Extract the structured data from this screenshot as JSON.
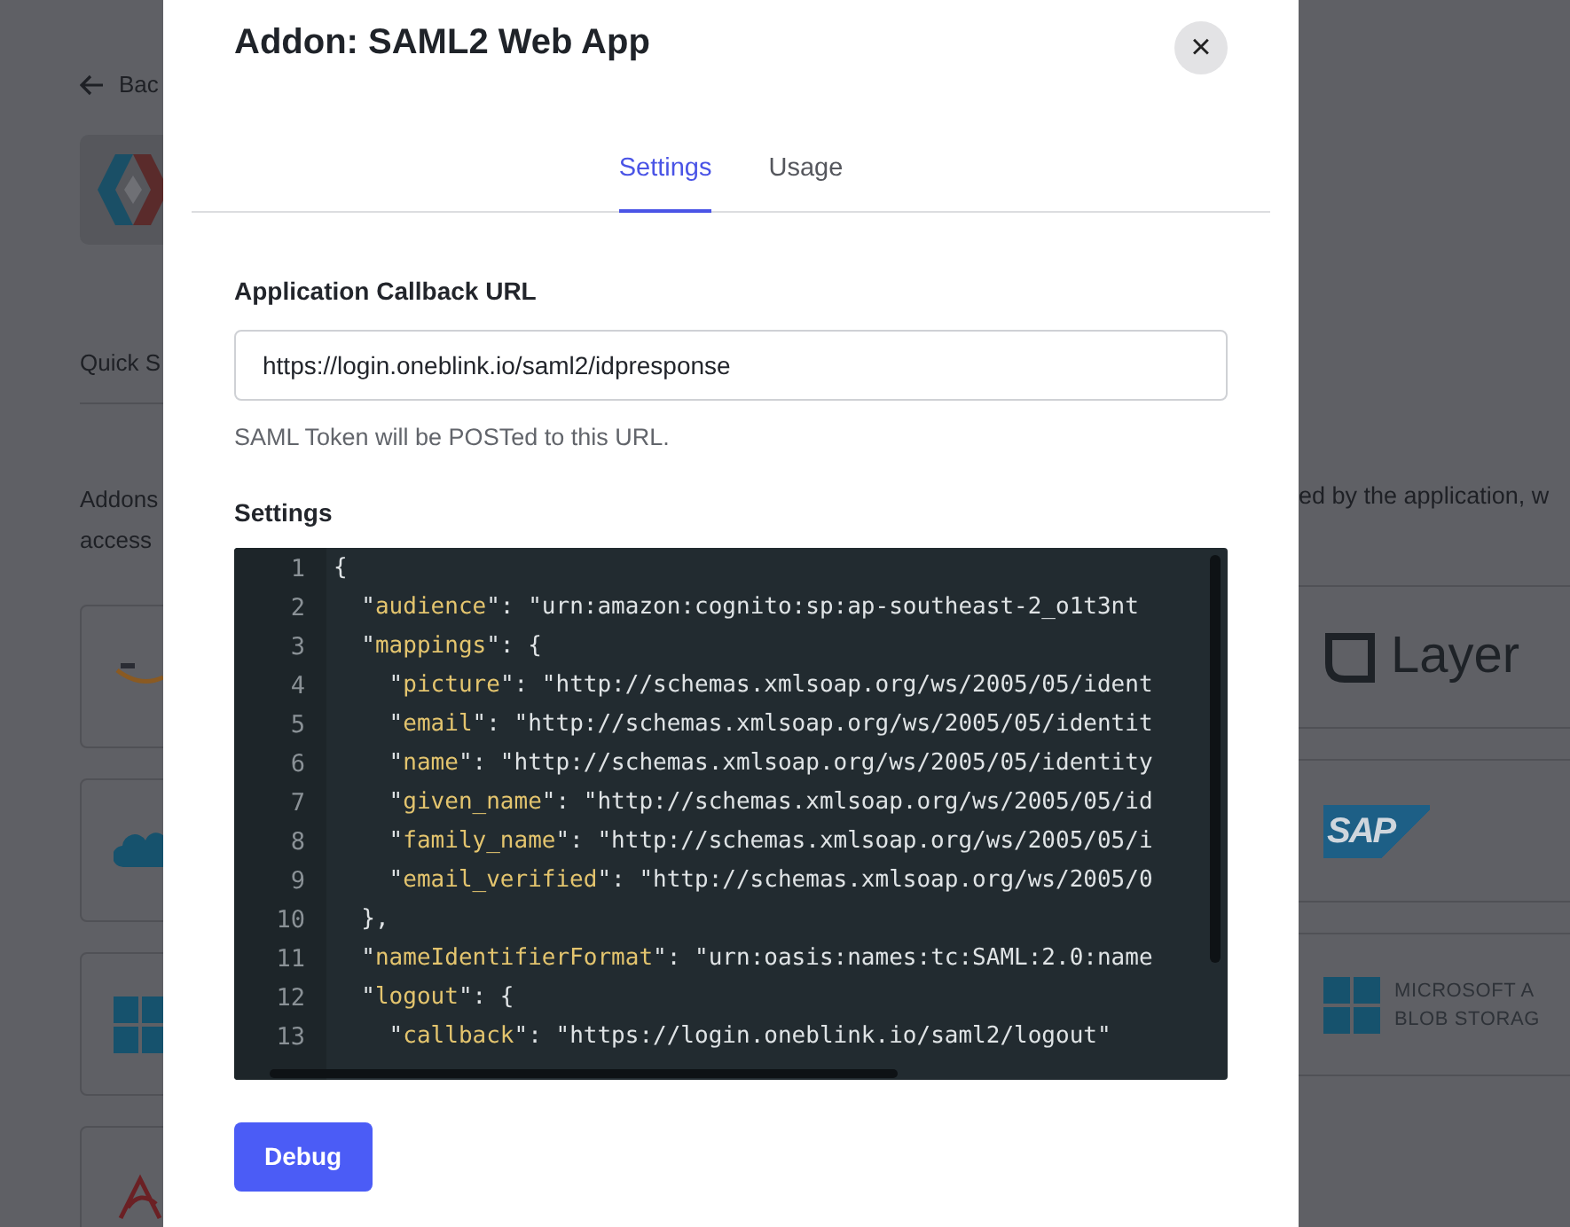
{
  "background_page": {
    "back_link": "Bac",
    "quick_section": "Quick S",
    "intro_left": [
      "Addons",
      "access"
    ],
    "intro_right": "ed by the application, w",
    "right_cards": [
      {
        "kind": "layer",
        "label": "Layer"
      },
      {
        "kind": "sap",
        "label": "SAP"
      },
      {
        "kind": "microsoft",
        "label_lines": [
          "MICROSOFT A",
          "BLOB STORAG"
        ]
      }
    ],
    "left_cards": [
      {
        "kind": "aws"
      },
      {
        "kind": "cloud"
      },
      {
        "kind": "microsoft"
      },
      {
        "kind": "swirl"
      }
    ]
  },
  "modal": {
    "title": "Addon: SAML2 Web App",
    "close": "×",
    "tabs": [
      {
        "label": "Settings",
        "selected": true
      },
      {
        "label": "Usage",
        "selected": false
      }
    ],
    "callback_field": {
      "label": "Application Callback URL",
      "value": "https://login.oneblink.io/saml2/idpresponse",
      "help": "SAML Token will be POSTed to this URL."
    },
    "settings": {
      "label": "Settings",
      "lines": [
        {
          "number": "1",
          "tokens": [
            {
              "kind": "plain",
              "text": "{"
            }
          ]
        },
        {
          "number": "2",
          "tokens": [
            {
              "kind": "plain",
              "text": "  \""
            },
            {
              "kind": "key",
              "text": "audience"
            },
            {
              "kind": "plain",
              "text": "\": \"urn:amazon:cognito:sp:ap-southeast-2_o1t3nt"
            }
          ]
        },
        {
          "number": "3",
          "tokens": [
            {
              "kind": "plain",
              "text": "  \""
            },
            {
              "kind": "key",
              "text": "mappings"
            },
            {
              "kind": "plain",
              "text": "\": {"
            }
          ]
        },
        {
          "number": "4",
          "tokens": [
            {
              "kind": "plain",
              "text": "    \""
            },
            {
              "kind": "key",
              "text": "picture"
            },
            {
              "kind": "plain",
              "text": "\": \"http://schemas.xmlsoap.org/ws/2005/05/ident"
            }
          ]
        },
        {
          "number": "5",
          "tokens": [
            {
              "kind": "plain",
              "text": "    \""
            },
            {
              "kind": "key",
              "text": "email"
            },
            {
              "kind": "plain",
              "text": "\": \"http://schemas.xmlsoap.org/ws/2005/05/identit"
            }
          ]
        },
        {
          "number": "6",
          "tokens": [
            {
              "kind": "plain",
              "text": "    \""
            },
            {
              "kind": "key",
              "text": "name"
            },
            {
              "kind": "plain",
              "text": "\": \"http://schemas.xmlsoap.org/ws/2005/05/identity"
            }
          ]
        },
        {
          "number": "7",
          "tokens": [
            {
              "kind": "plain",
              "text": "    \""
            },
            {
              "kind": "key",
              "text": "given_name"
            },
            {
              "kind": "plain",
              "text": "\": \"http://schemas.xmlsoap.org/ws/2005/05/id"
            }
          ]
        },
        {
          "number": "8",
          "tokens": [
            {
              "kind": "plain",
              "text": "    \""
            },
            {
              "kind": "key",
              "text": "family_name"
            },
            {
              "kind": "plain",
              "text": "\": \"http://schemas.xmlsoap.org/ws/2005/05/i"
            }
          ]
        },
        {
          "number": "9",
          "tokens": [
            {
              "kind": "plain",
              "text": "    \""
            },
            {
              "kind": "key",
              "text": "email_verified"
            },
            {
              "kind": "plain",
              "text": "\": \"http://schemas.xmlsoap.org/ws/2005/0"
            }
          ]
        },
        {
          "number": "10",
          "tokens": [
            {
              "kind": "plain",
              "text": "  },"
            }
          ]
        },
        {
          "number": "11",
          "tokens": [
            {
              "kind": "plain",
              "text": "  \""
            },
            {
              "kind": "key",
              "text": "nameIdentifierFormat"
            },
            {
              "kind": "plain",
              "text": "\": \"urn:oasis:names:tc:SAML:2.0:name"
            }
          ]
        },
        {
          "number": "12",
          "tokens": [
            {
              "kind": "plain",
              "text": "  \""
            },
            {
              "kind": "key",
              "text": "logout"
            },
            {
              "kind": "plain",
              "text": "\": {"
            }
          ]
        },
        {
          "number": "13",
          "tokens": [
            {
              "kind": "plain",
              "text": "    \""
            },
            {
              "kind": "key",
              "text": "callback"
            },
            {
              "kind": "plain",
              "text": "\": \"https://login.oneblink.io/saml2/logout\""
            }
          ]
        }
      ]
    },
    "debug_button": "Debug"
  }
}
